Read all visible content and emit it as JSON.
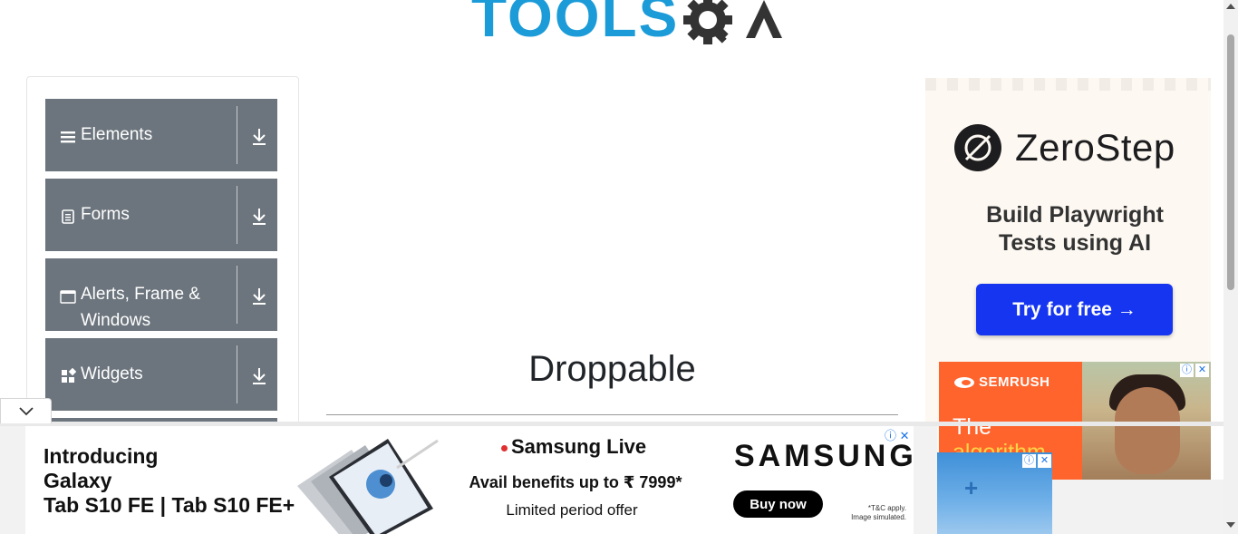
{
  "header": {
    "logo_text": "TOOLSQA",
    "logo_visible": "TOOLS"
  },
  "sidebar": {
    "groups": [
      {
        "label": "Elements",
        "icon": "hamburger-icon"
      },
      {
        "label": "Forms",
        "icon": "document-icon"
      },
      {
        "label": "Alerts, Frame &",
        "label2": "Windows",
        "icon": "window-icon"
      },
      {
        "label": "Widgets",
        "icon": "widgets-icon"
      }
    ]
  },
  "main": {
    "title": "Droppable"
  },
  "ads": {
    "zerostep": {
      "brand": "ZeroStep",
      "line1": "Build Playwright",
      "line2": "Tests using AI",
      "button": "Try for free →"
    },
    "semrush": {
      "brand": "SEMRUSH",
      "line1": "The",
      "line2": "algorithm"
    },
    "samsung": {
      "intro1": "Introducing",
      "intro2": "Galaxy",
      "intro3": "Tab S10 FE | Tab S10 FE+",
      "live": "Samsung Live",
      "avail": "Avail benefits up to ₹ 7999*",
      "limited": "Limited period offer",
      "brand": "SAMSUNG",
      "button": "Buy now",
      "tc1": "*T&C apply.",
      "tc2": "Image simulated."
    }
  },
  "colors": {
    "sidebar_group_bg": "#6c757d",
    "logo_blue": "#1b9bd8",
    "zerostep_button": "#1535f0",
    "semrush_orange": "#ff642d"
  }
}
